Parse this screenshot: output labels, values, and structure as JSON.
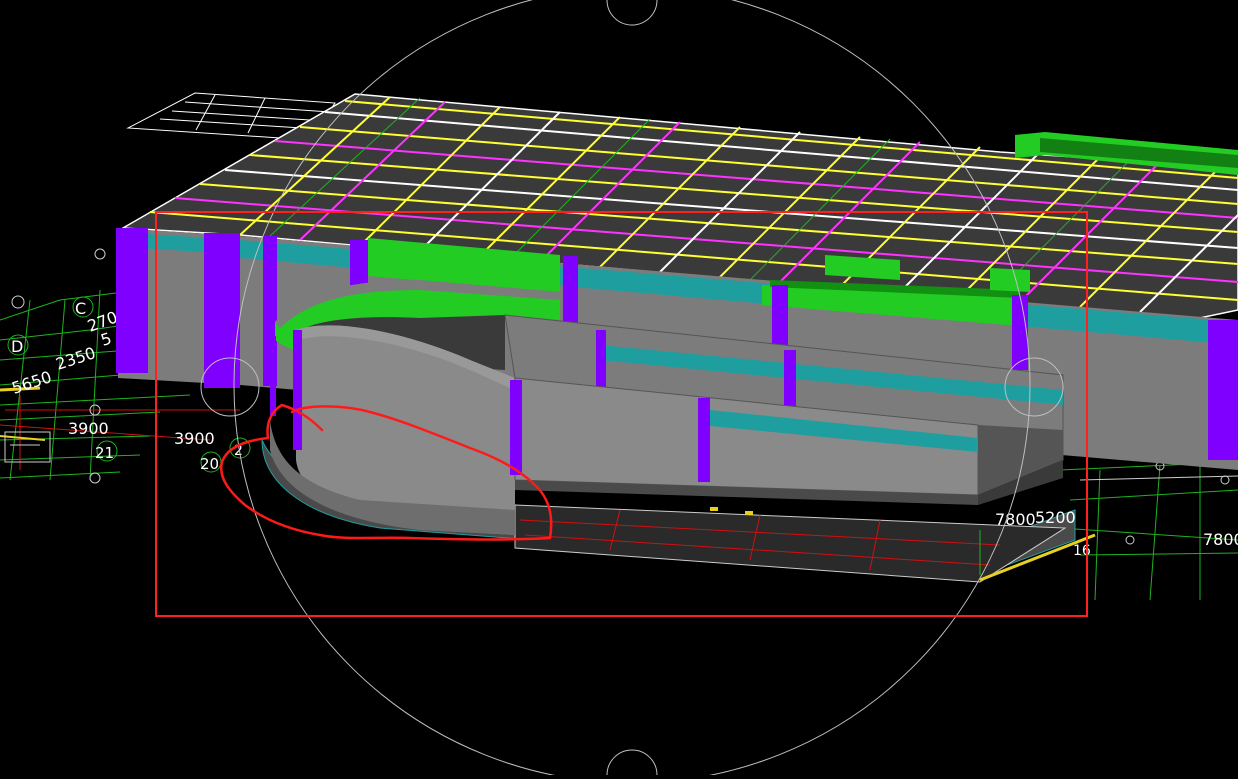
{
  "viewport": {
    "name": "3D model viewport",
    "axis_labels": {
      "c": "C",
      "d": "D",
      "n20": "20",
      "n21": "21",
      "n2": "2",
      "n16": "16"
    },
    "dimensions": {
      "d270": "270",
      "d2350": "2350",
      "d5": "5",
      "d5650": "5650",
      "d3900a": "3900",
      "d3900b": "3900",
      "d7800a": "7800",
      "d5200": "5200",
      "d7800b": "7800"
    }
  },
  "colors": {
    "background": "#000000",
    "column": "#8000ff",
    "beam_green": "#22cc22",
    "slab_top": "#3a3a3a",
    "wall": "#7c7c7c",
    "stripe_teal": "#1f9ea0",
    "grid_yellow": "#ffff33",
    "grid_magenta": "#ff33ff",
    "selection_box": "#ff2020",
    "annotation": "#ff1a1a"
  },
  "icons": [
    "navigation-orbit-circle",
    "pivot-marker"
  ]
}
